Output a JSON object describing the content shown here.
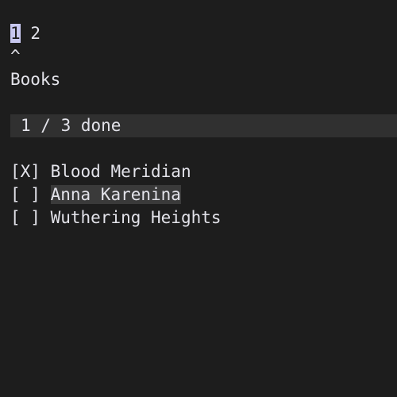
{
  "tabs": [
    {
      "label": "1",
      "active": true
    },
    {
      "label": "2",
      "active": false
    }
  ],
  "tab_separator": " ",
  "caret": "^",
  "list_title": "Books",
  "status": {
    "completed": "1",
    "total": "3",
    "text": "1 / 3 done"
  },
  "items": [
    {
      "checkbox": "[X]",
      "label": "Blood Meridian",
      "checked": true,
      "selected": false
    },
    {
      "checkbox": "[ ]",
      "label": "Anna Karenina",
      "checked": false,
      "selected": true
    },
    {
      "checkbox": "[ ]",
      "label": "Wuthering Heights",
      "checked": false,
      "selected": false
    }
  ],
  "colors": {
    "background": "#1d1d1d",
    "text": "#e3e3ea",
    "active_tab": "#c8c8f0",
    "status_bar": "#303030",
    "selection": "#3a3a3a"
  }
}
